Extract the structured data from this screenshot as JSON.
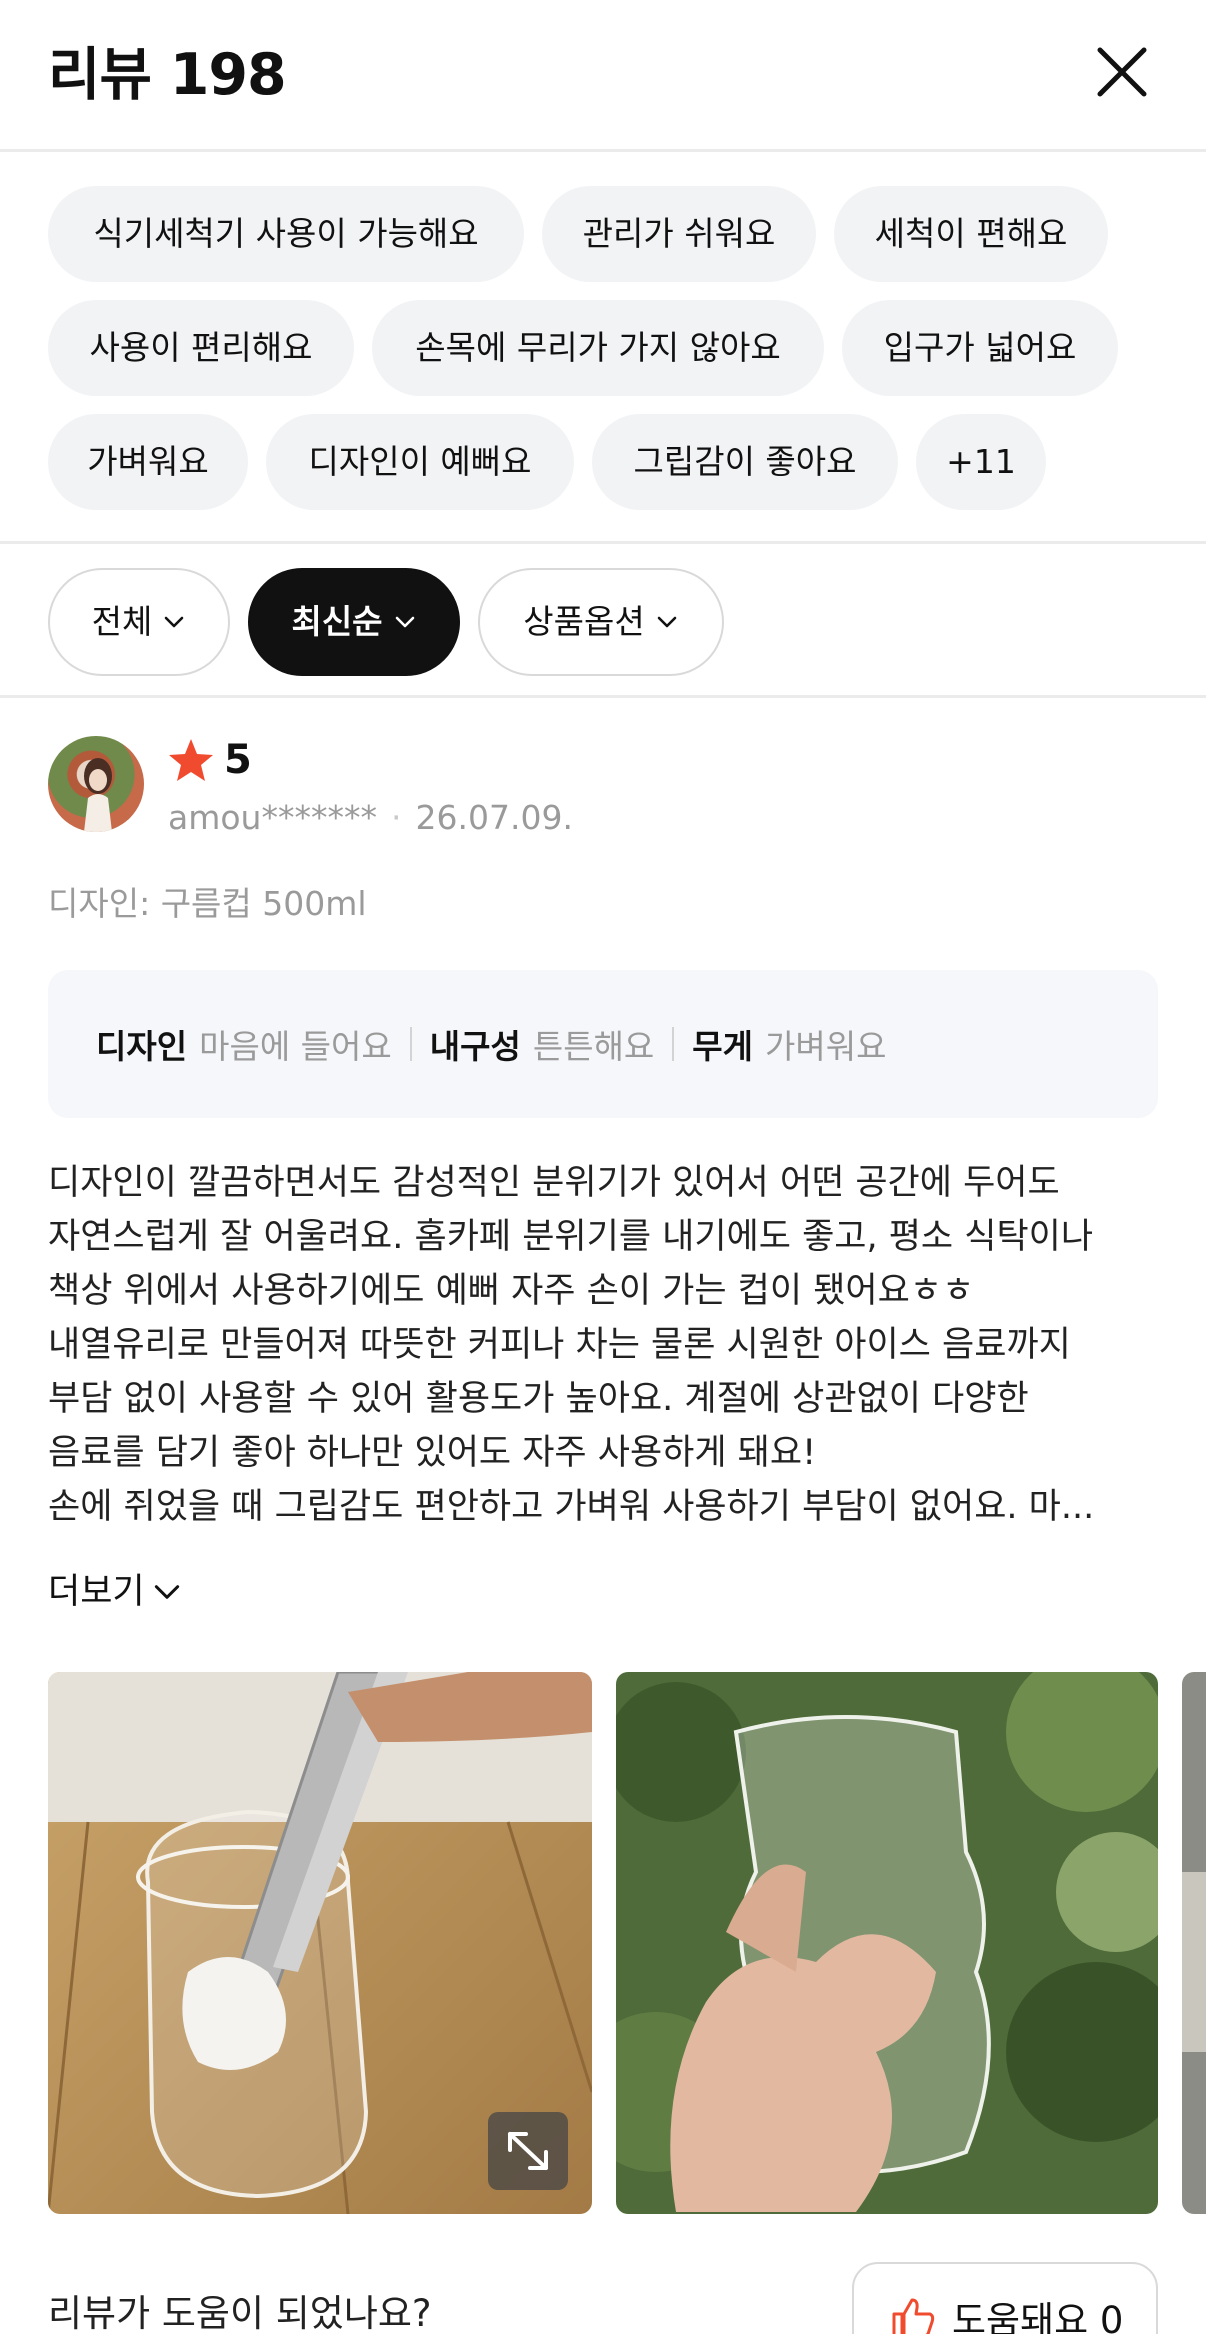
{
  "header": {
    "title": "리뷰 198"
  },
  "keywords": [
    "식기세척기 사용이 가능해요",
    "관리가 쉬워요",
    "세척이 편해요",
    "사용이 편리해요",
    "손목에 무리가 가지 않아요",
    "입구가 넓어요",
    "가벼워요",
    "디자인이 예뻐요",
    "그립감이 좋아요",
    "+11"
  ],
  "filters": {
    "all": "전체",
    "sort": "최신순",
    "option": "상품옵션"
  },
  "review": {
    "rating": "5",
    "user": "amou*******",
    "date": "26.07.09.",
    "option": "디자인: 구름컵 500ml",
    "attributes": [
      {
        "key": "디자인",
        "value": "마음에 들어요"
      },
      {
        "key": "내구성",
        "value": "튼튼해요"
      },
      {
        "key": "무게",
        "value": "가벼워요"
      }
    ],
    "lines": [
      "디자인이 깔끔하면서도 감성적인 분위기가 있어서 어떤 공간에 두어도",
      "자연스럽게 잘 어울려요. 홈카페 분위기를 내기에도 좋고, 평소 식탁이나",
      "책상 위에서 사용하기에도 예뻐 자주 손이 가는 컵이 됐어요ㅎㅎ",
      "내열유리로 만들어져 따뜻한 커피나 차는 물론 시원한 아이스 음료까지",
      "부담 없이 사용할 수 있어 활용도가 높아요. 계절에 상관없이 다양한",
      "음료를 담기 좋아 하나만 있어도 자주 사용하게 돼요!",
      "손에 쥐었을 때 그립감도 편안하고 가벼워 사용하기 부담이 없어요. 마..."
    ],
    "more_label": "더보기",
    "helpful_question": "리뷰가 도움이 되었나요?",
    "helpful_label": "도움돼요 0"
  },
  "colors": {
    "accent": "#111111",
    "star": "#f04b2e",
    "chip_bg": "#f2f3f5",
    "attr_bg": "#f5f7fa",
    "muted": "#9a9a9a"
  },
  "icons": [
    "close-icon",
    "chevron-down-icon",
    "star-icon",
    "expand-icon",
    "thumbs-up-icon"
  ]
}
